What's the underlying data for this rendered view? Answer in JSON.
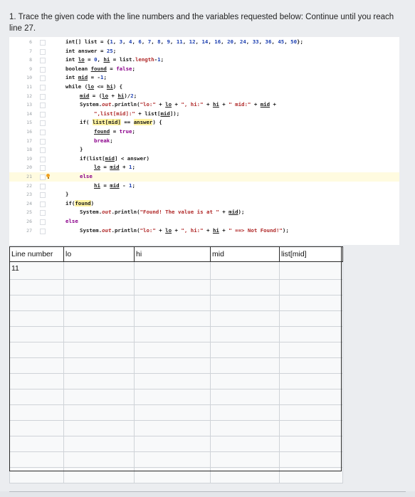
{
  "question": {
    "text": "1. Trace the given code with the line numbers and the variables requested below: Continue until you reach line 27."
  },
  "code_lines": [
    {
      "num": "6",
      "segs": [
        [
          "k",
          "int[] "
        ],
        [
          "k",
          "list = {"
        ],
        [
          "num",
          "1"
        ],
        [
          "k",
          ", "
        ],
        [
          "num",
          "3"
        ],
        [
          "k",
          ", "
        ],
        [
          "num",
          "4"
        ],
        [
          "k",
          ", "
        ],
        [
          "num",
          "6"
        ],
        [
          "k",
          ", "
        ],
        [
          "num",
          "7"
        ],
        [
          "k",
          ", "
        ],
        [
          "num",
          "8"
        ],
        [
          "k",
          ", "
        ],
        [
          "num",
          "9"
        ],
        [
          "k",
          ", "
        ],
        [
          "num",
          "11"
        ],
        [
          "k",
          ", "
        ],
        [
          "num",
          "12"
        ],
        [
          "k",
          ", "
        ],
        [
          "num",
          "14"
        ],
        [
          "k",
          ", "
        ],
        [
          "num",
          "16"
        ],
        [
          "k",
          ", "
        ],
        [
          "num",
          "20"
        ],
        [
          "k",
          ", "
        ],
        [
          "num",
          "24"
        ],
        [
          "k",
          ", "
        ],
        [
          "num",
          "33"
        ],
        [
          "k",
          ", "
        ],
        [
          "num",
          "36"
        ],
        [
          "k",
          ", "
        ],
        [
          "num",
          "45"
        ],
        [
          "k",
          ", "
        ],
        [
          "num",
          "50"
        ],
        [
          "k",
          "};"
        ]
      ],
      "indent": 0
    },
    {
      "num": "7",
      "segs": [
        [
          "k",
          "int answer = "
        ],
        [
          "num",
          "25"
        ],
        [
          "k",
          ";"
        ]
      ],
      "indent": 0
    },
    {
      "num": "8",
      "segs": [
        [
          "k",
          "int "
        ],
        [
          "u",
          "lo"
        ],
        [
          "k",
          " = "
        ],
        [
          "num",
          "0"
        ],
        [
          "k",
          ", "
        ],
        [
          "u",
          "hi"
        ],
        [
          "k",
          " = list."
        ],
        [
          "str",
          "length"
        ],
        [
          "k",
          "-"
        ],
        [
          "num",
          "1"
        ],
        [
          "k",
          ";"
        ]
      ],
      "indent": 0
    },
    {
      "num": "9",
      "segs": [
        [
          "k",
          "boolean "
        ],
        [
          "u",
          "found"
        ],
        [
          "k",
          " = "
        ],
        [
          "kw",
          "false"
        ],
        [
          "k",
          ";"
        ]
      ],
      "indent": 0
    },
    {
      "num": "10",
      "segs": [
        [
          "k",
          "int "
        ],
        [
          "u",
          "mid"
        ],
        [
          "k",
          " = -"
        ],
        [
          "num",
          "1"
        ],
        [
          "k",
          ";"
        ]
      ],
      "indent": 0
    },
    {
      "num": "11",
      "segs": [
        [
          "k",
          "while ("
        ],
        [
          "u",
          "lo"
        ],
        [
          "k",
          " <= "
        ],
        [
          "u",
          "hi"
        ],
        [
          "k",
          ") {"
        ]
      ],
      "indent": 0
    },
    {
      "num": "12",
      "segs": [
        [
          "u",
          "mid"
        ],
        [
          "k",
          " = ("
        ],
        [
          "u",
          "lo"
        ],
        [
          "k",
          " + "
        ],
        [
          "u",
          "hi"
        ],
        [
          "k",
          ")/"
        ],
        [
          "num",
          "2"
        ],
        [
          "k",
          ";"
        ]
      ],
      "indent": 1
    },
    {
      "num": "13",
      "segs": [
        [
          "k",
          "System."
        ],
        [
          "fld",
          "out"
        ],
        [
          "k",
          ".println("
        ],
        [
          "str",
          "\"lo:\""
        ],
        [
          "k",
          " + "
        ],
        [
          "u",
          "lo"
        ],
        [
          "k",
          " + "
        ],
        [
          "str",
          "\", hi:\""
        ],
        [
          "k",
          " + "
        ],
        [
          "u",
          "hi"
        ],
        [
          "k",
          " + "
        ],
        [
          "str",
          "\" mid:\""
        ],
        [
          "k",
          " + "
        ],
        [
          "u",
          "mid"
        ],
        [
          "k",
          " +"
        ]
      ],
      "indent": 1
    },
    {
      "num": "14",
      "segs": [
        [
          "str",
          "\",list[mid]:\""
        ],
        [
          "k",
          " + list["
        ],
        [
          "u",
          "mid"
        ],
        [
          "k",
          "]);"
        ]
      ],
      "indent": 2
    },
    {
      "num": "15",
      "segs": [
        [
          "k",
          "if( "
        ],
        [
          "mark",
          "list["
        ],
        [
          "mark",
          "mid"
        ],
        [
          "mark",
          "]"
        ],
        [
          "k",
          " == "
        ],
        [
          "mark",
          "answer"
        ],
        [
          "k",
          ") {"
        ]
      ],
      "indent": 1
    },
    {
      "num": "16",
      "segs": [
        [
          "u",
          "found"
        ],
        [
          "k",
          " = "
        ],
        [
          "kw",
          "true"
        ],
        [
          "k",
          ";"
        ]
      ],
      "indent": 2
    },
    {
      "num": "17",
      "segs": [
        [
          "kw",
          "break"
        ],
        [
          "k",
          ";"
        ]
      ],
      "indent": 2
    },
    {
      "num": "18",
      "segs": [
        [
          "k",
          "}"
        ]
      ],
      "indent": 1
    },
    {
      "num": "19",
      "segs": [
        [
          "k",
          "if(list["
        ],
        [
          "u",
          "mid"
        ],
        [
          "k",
          "] < answer)"
        ]
      ],
      "indent": 1
    },
    {
      "num": "20",
      "segs": [
        [
          "u",
          "lo"
        ],
        [
          "k",
          " = "
        ],
        [
          "u",
          "mid"
        ],
        [
          "k",
          " + "
        ],
        [
          "num",
          "1"
        ],
        [
          "k",
          ";"
        ]
      ],
      "indent": 2
    },
    {
      "num": "21",
      "segs": [
        [
          "kw",
          "else"
        ]
      ],
      "indent": 1
    },
    {
      "num": "22",
      "segs": [
        [
          "u",
          "hi"
        ],
        [
          "k",
          " = "
        ],
        [
          "u",
          "mid"
        ],
        [
          "k",
          " - "
        ],
        [
          "num",
          "1"
        ],
        [
          "k",
          ";"
        ]
      ],
      "indent": 2
    },
    {
      "num": "23",
      "segs": [
        [
          "k",
          "}"
        ]
      ],
      "indent": 0
    },
    {
      "num": "24",
      "segs": [
        [
          "k",
          "if("
        ],
        [
          "mark",
          "found"
        ],
        [
          "k",
          ")"
        ]
      ],
      "indent": 0
    },
    {
      "num": "25",
      "segs": [
        [
          "k",
          "System."
        ],
        [
          "fld",
          "out"
        ],
        [
          "k",
          ".println("
        ],
        [
          "str",
          "\"Found! The value is at \""
        ],
        [
          "k",
          " + "
        ],
        [
          "u",
          "mid"
        ],
        [
          "k",
          ");"
        ]
      ],
      "indent": 1
    },
    {
      "num": "26",
      "segs": [
        [
          "kw",
          "else"
        ]
      ],
      "indent": 0
    },
    {
      "num": "27",
      "segs": [
        [
          "k",
          "System."
        ],
        [
          "fld",
          "out"
        ],
        [
          "k",
          ".println("
        ],
        [
          "str",
          "\"lo:\""
        ],
        [
          "k",
          " + "
        ],
        [
          "u",
          "lo"
        ],
        [
          "k",
          " + "
        ],
        [
          "str",
          "\", hi:\""
        ],
        [
          "k",
          " + "
        ],
        [
          "u",
          "hi"
        ],
        [
          "k",
          " + "
        ],
        [
          "str",
          "\" ==> Not Found!\""
        ],
        [
          "k",
          ");"
        ]
      ],
      "indent": 1
    }
  ],
  "highlighted_line": "21",
  "table": {
    "headers": [
      "Line number",
      "lo",
      "hi",
      "mid",
      "list[mid]"
    ],
    "rows": [
      [
        "11",
        "",
        "",
        "",
        ""
      ],
      [
        "",
        "",
        "",
        "",
        ""
      ],
      [
        "",
        "",
        "",
        "",
        ""
      ],
      [
        "",
        "",
        "",
        "",
        ""
      ],
      [
        "",
        "",
        "",
        "",
        ""
      ],
      [
        "",
        "",
        "",
        "",
        ""
      ],
      [
        "",
        "",
        "",
        "",
        ""
      ],
      [
        "",
        "",
        "",
        "",
        ""
      ],
      [
        "",
        "",
        "",
        "",
        ""
      ],
      [
        "",
        "",
        "",
        "",
        ""
      ],
      [
        "",
        "",
        "",
        "",
        ""
      ],
      [
        "",
        "",
        "",
        "",
        ""
      ],
      [
        "",
        "",
        "",
        "",
        ""
      ],
      [
        "",
        "",
        "",
        "",
        ""
      ]
    ]
  }
}
